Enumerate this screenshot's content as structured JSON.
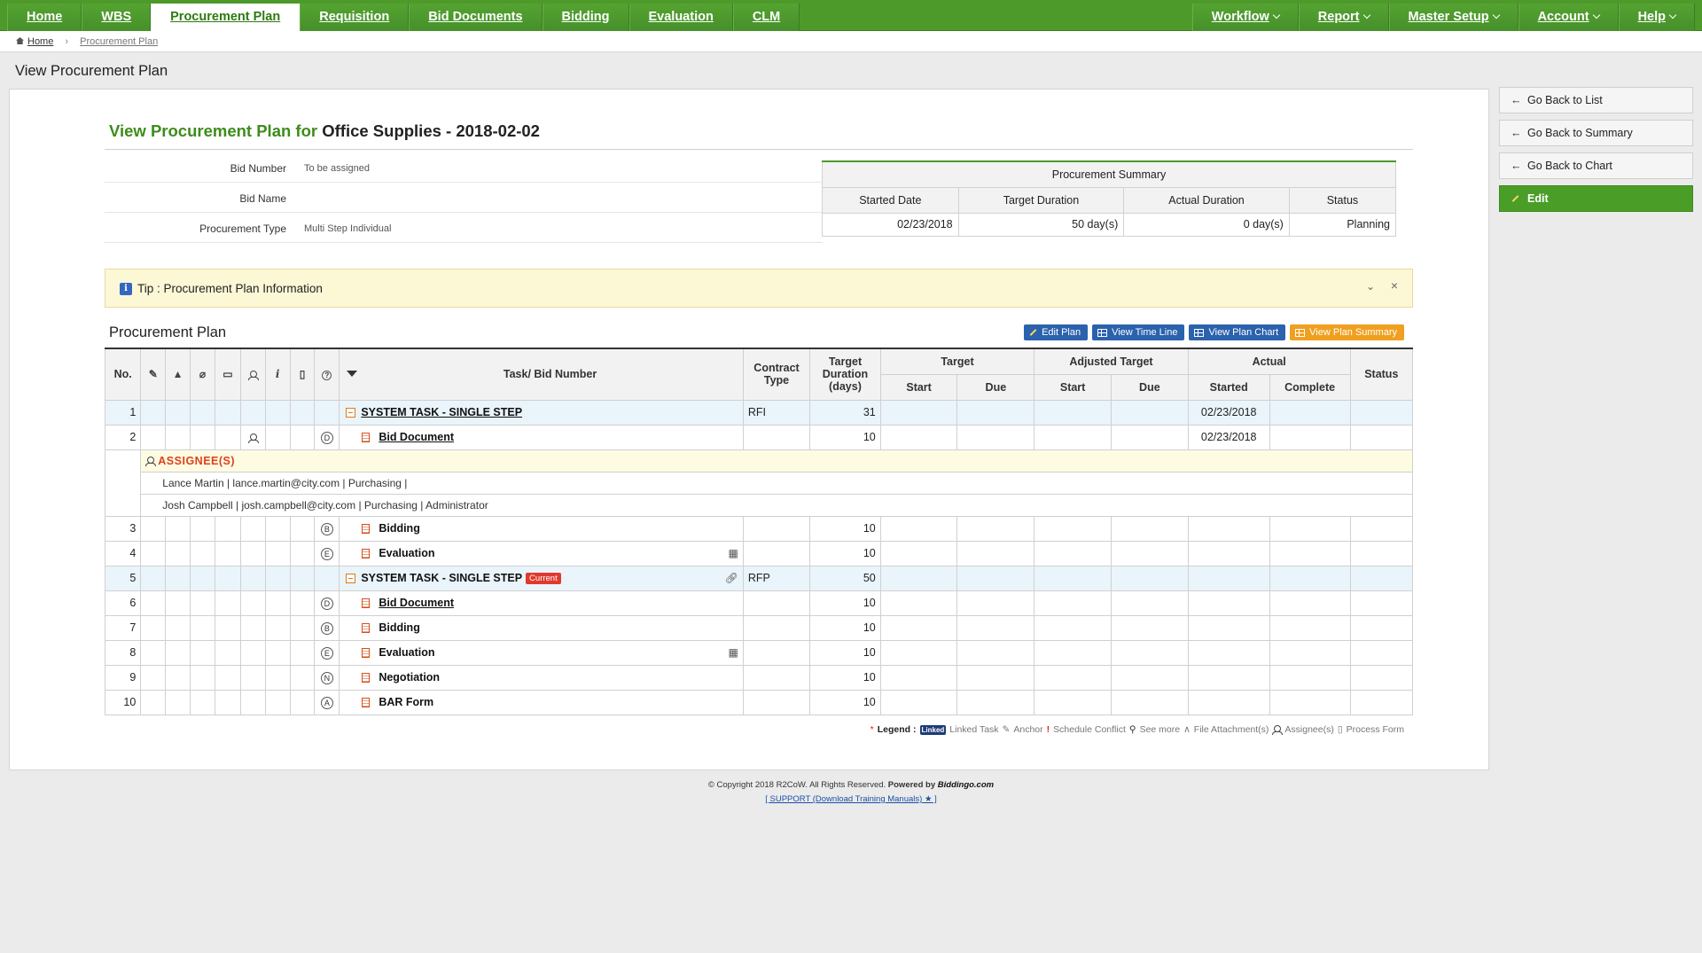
{
  "nav": {
    "left": [
      "Home",
      "WBS",
      "Procurement Plan",
      "Requisition",
      "Bid Documents",
      "Bidding",
      "Evaluation",
      "CLM"
    ],
    "active_index": 2,
    "right": [
      "Workflow",
      "Report",
      "Master Setup",
      "Account",
      "Help"
    ]
  },
  "breadcrumb": {
    "home": "Home",
    "current": "Procurement Plan"
  },
  "page_heading": "View Procurement Plan",
  "title": {
    "prefix": "View Procurement Plan for",
    "subject": "Office Supplies - 2018-02-02"
  },
  "info": {
    "bid_number_label": "Bid Number",
    "bid_number_value": "To be assigned",
    "bid_name_label": "Bid Name",
    "bid_name_value": "",
    "procurement_type_label": "Procurement Type",
    "procurement_type_value": "Multi Step Individual"
  },
  "summary": {
    "title": "Procurement Summary",
    "headers": [
      "Started Date",
      "Target Duration",
      "Actual Duration",
      "Status"
    ],
    "values": [
      "02/23/2018",
      "50 day(s)",
      "0 day(s)",
      "Planning"
    ]
  },
  "tip": {
    "icon": "i",
    "text": "Tip : Procurement Plan Information"
  },
  "plan_heading": "Procurement Plan",
  "plan_buttons": [
    "Edit Plan",
    "View Time Line",
    "View Plan Chart",
    "View Plan Summary"
  ],
  "table": {
    "headers": {
      "no": "No.",
      "task": "Task/ Bid Number",
      "contract_type": "Contract Type",
      "target_duration": "Target Duration (days)",
      "target": "Target",
      "adjusted_target": "Adjusted Target",
      "actual": "Actual",
      "status": "Status",
      "start": "Start",
      "due": "Due",
      "started": "Started",
      "complete": "Complete"
    },
    "rows": [
      {
        "no": "1",
        "letter": "",
        "task": "SYSTEM TASK - SINGLE STEP",
        "contract": "RFI",
        "duration": "31",
        "actual_started": "02/23/2018"
      },
      {
        "no": "2",
        "letter": "D",
        "task": "Bid Document",
        "contract": "",
        "duration": "10",
        "actual_started": "02/23/2018"
      },
      {
        "no": "3",
        "letter": "B",
        "task": "Bidding",
        "contract": "",
        "duration": "10",
        "actual_started": ""
      },
      {
        "no": "4",
        "letter": "E",
        "task": "Evaluation",
        "contract": "",
        "duration": "10",
        "actual_started": ""
      },
      {
        "no": "5",
        "letter": "",
        "task": "SYSTEM TASK - SINGLE STEP",
        "badge": "Current",
        "contract": "RFP",
        "duration": "50",
        "actual_started": ""
      },
      {
        "no": "6",
        "letter": "D",
        "task": "Bid Document",
        "contract": "",
        "duration": "10",
        "actual_started": ""
      },
      {
        "no": "7",
        "letter": "B",
        "task": "Bidding",
        "contract": "",
        "duration": "10",
        "actual_started": ""
      },
      {
        "no": "8",
        "letter": "E",
        "task": "Evaluation",
        "contract": "",
        "duration": "10",
        "actual_started": ""
      },
      {
        "no": "9",
        "letter": "N",
        "task": "Negotiation",
        "contract": "",
        "duration": "10",
        "actual_started": ""
      },
      {
        "no": "10",
        "letter": "A",
        "task": "BAR Form",
        "contract": "",
        "duration": "10",
        "actual_started": ""
      }
    ],
    "assignees": {
      "title": "ASSIGNEE(S)",
      "people": [
        "Lance Martin | lance.martin@city.com | Purchasing |",
        "Josh Campbell | josh.campbell@city.com | Purchasing | Administrator"
      ]
    }
  },
  "legend": {
    "star": "*",
    "title": "Legend :",
    "linked_badge": "Linked",
    "linked": "Linked Task",
    "anchor": "Anchor",
    "conflict": "Schedule Conflict",
    "see_more": "See more",
    "file": "File Attachment(s)",
    "assignee": "Assignee(s)",
    "process": "Process Form"
  },
  "side_buttons": [
    "Go Back to List",
    "Go Back to Summary",
    "Go Back to Chart",
    "Edit"
  ],
  "footer": {
    "copyright": "© Copyright 2018 R2CoW. All Rights Reserved.",
    "powered": "Powered by",
    "brand": "Biddingo.com",
    "support": "[ SUPPORT (Download Training Manuals) ★ ]"
  },
  "colors": {
    "nav_green": "#4d9a2b",
    "title_green": "#3d8c1b",
    "button_blue": "#2b62ad",
    "button_orange": "#f0a020",
    "current_badge": "#e03a2e"
  }
}
